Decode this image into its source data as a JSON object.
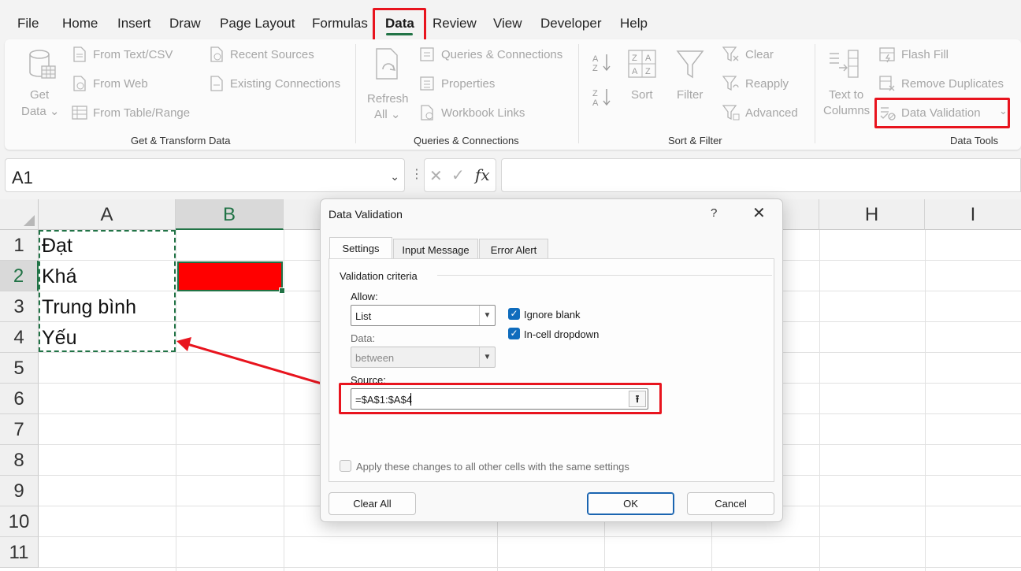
{
  "menu": {
    "items": [
      "File",
      "Home",
      "Insert",
      "Draw",
      "Page Layout",
      "Formulas",
      "Data",
      "Review",
      "View",
      "Developer",
      "Help"
    ],
    "active": "Data"
  },
  "ribbon": {
    "get_transform": {
      "get_data": [
        "Get",
        "Data ⌄"
      ],
      "from_text_csv": "From Text/CSV",
      "from_web": "From Web",
      "from_table_range": "From Table/Range",
      "recent_sources": "Recent Sources",
      "existing_connections": "Existing Connections",
      "label": "Get & Transform Data"
    },
    "queries": {
      "refresh_all": [
        "Refresh",
        "All ⌄"
      ],
      "queries_connections": "Queries & Connections",
      "properties": "Properties",
      "workbook_links": "Workbook Links",
      "label": "Queries & Connections"
    },
    "sort_filter": {
      "sort": "Sort",
      "filter": "Filter",
      "clear": "Clear",
      "reapply": "Reapply",
      "advanced": "Advanced",
      "label": "Sort & Filter"
    },
    "data_tools": {
      "text_to_columns": [
        "Text to",
        "Columns"
      ],
      "flash_fill": "Flash Fill",
      "remove_duplicates": "Remove Duplicates",
      "data_validation": "Data Validation",
      "label": "Data Tools"
    }
  },
  "formula_bar": {
    "name_box": "A1",
    "fx": "fx",
    "formula": ""
  },
  "sheet": {
    "columns": [
      "A",
      "B",
      "H",
      "I"
    ],
    "rows": [
      "1",
      "2",
      "3",
      "4",
      "5",
      "6",
      "7",
      "8",
      "9",
      "10",
      "11"
    ],
    "cells": {
      "A1": "Đạt",
      "A2": " Khá",
      "A3": " Trung bình",
      "A4": " Yếu"
    },
    "fill_color_B2": "#ff0000",
    "selection_color": "#217346"
  },
  "dialog": {
    "title": "Data Validation",
    "help": "?",
    "close": "✕",
    "tabs": [
      "Settings",
      "Input Message",
      "Error Alert"
    ],
    "active_tab": "Settings",
    "group_label": "Validation criteria",
    "allow_label": "Allow:",
    "allow_value": "List",
    "ignore_blank": "Ignore blank",
    "ignore_blank_checked": true,
    "in_cell_dropdown": "In-cell dropdown",
    "in_cell_dropdown_checked": true,
    "data_label": "Data:",
    "data_value": "between",
    "source_label": "Source:",
    "source_value": "=$A$1:$A$4",
    "apply_all": "Apply these changes to all other cells with the same settings",
    "apply_all_checked": false,
    "buttons": {
      "clear_all": "Clear All",
      "ok": "OK",
      "cancel": "Cancel"
    }
  },
  "annotation_color": "#e8141e"
}
